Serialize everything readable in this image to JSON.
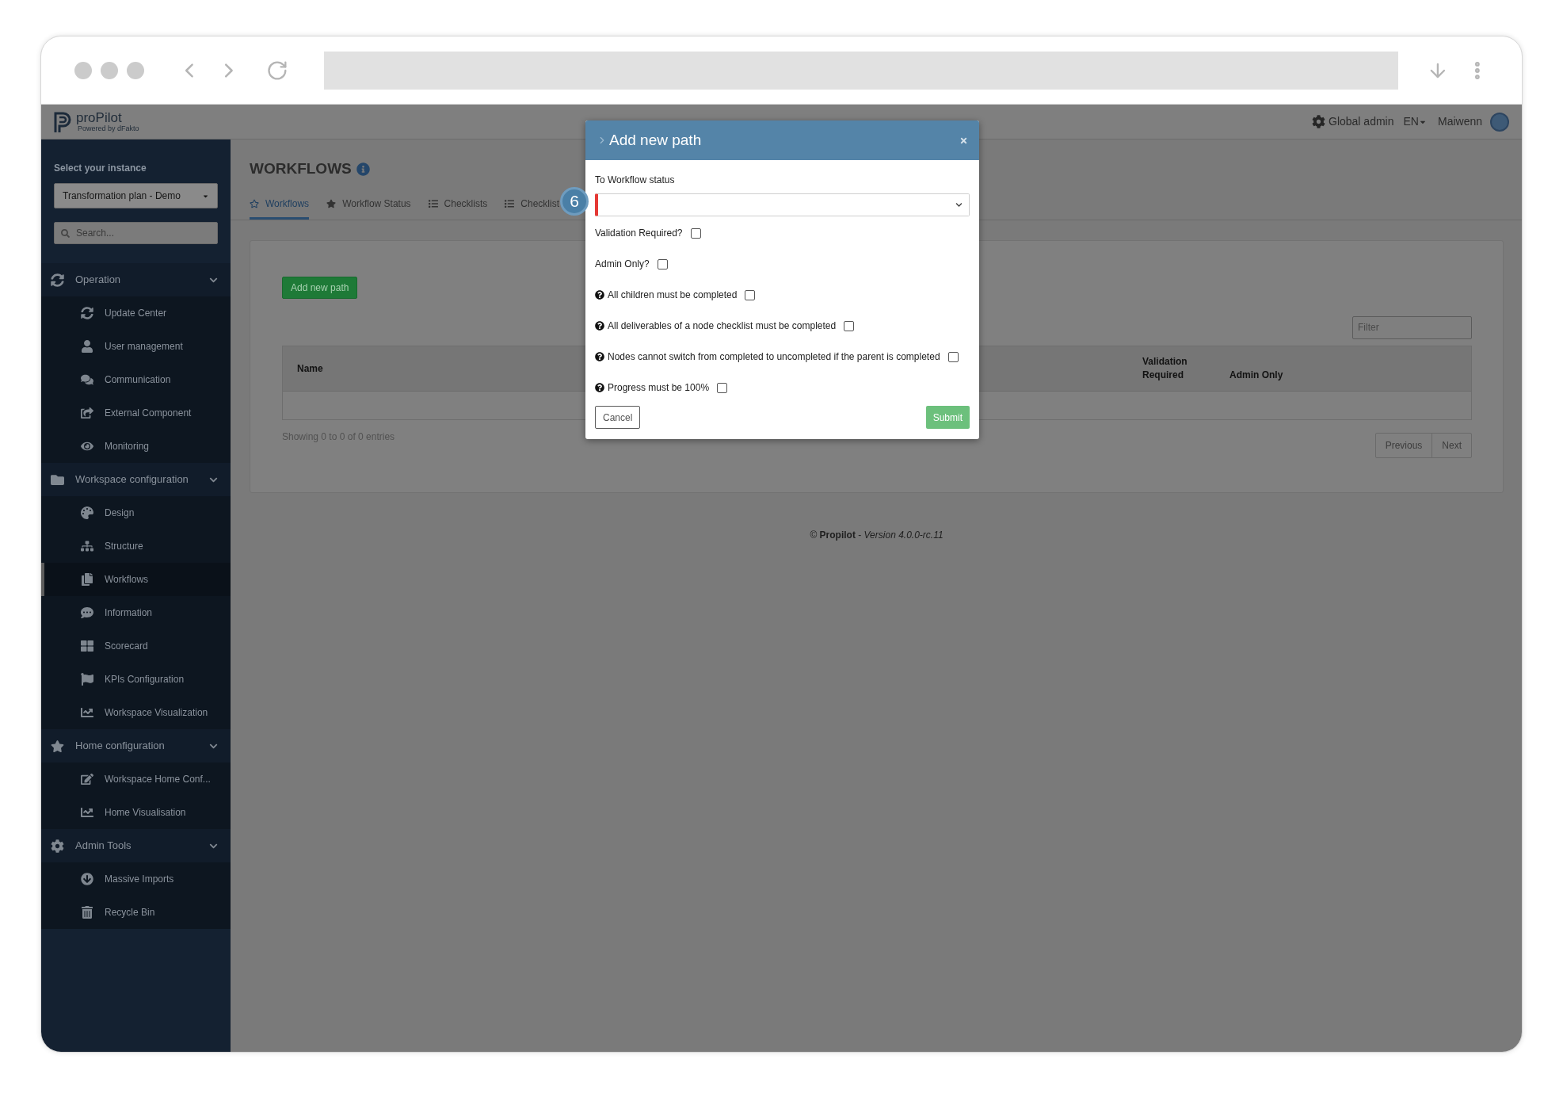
{
  "header": {
    "logo": "proPilot",
    "logo_tagline": "Powered by dFakto",
    "role": "Global admin",
    "language": "EN",
    "user": "Maiwenn"
  },
  "sidebar": {
    "instance_label": "Select your instance",
    "instance_value": "Transformation plan - Demo",
    "search_placeholder": "Search...",
    "groups": [
      {
        "label": "Operation",
        "expanded": true,
        "items": [
          {
            "label": "Update Center",
            "selected": false
          },
          {
            "label": "User management",
            "selected": false
          },
          {
            "label": "Communication",
            "selected": false
          },
          {
            "label": "External Component",
            "selected": false
          },
          {
            "label": "Monitoring",
            "selected": false
          }
        ]
      },
      {
        "label": "Workspace configuration",
        "expanded": true,
        "items": [
          {
            "label": "Design",
            "selected": false
          },
          {
            "label": "Structure",
            "selected": false
          },
          {
            "label": "Workflows",
            "selected": true
          },
          {
            "label": "Information",
            "selected": false
          },
          {
            "label": "Scorecard",
            "selected": false
          },
          {
            "label": "KPIs Configuration",
            "selected": false
          },
          {
            "label": "Workspace Visualization",
            "selected": false
          }
        ]
      },
      {
        "label": "Home configuration",
        "expanded": true,
        "items": [
          {
            "label": "Workspace Home Conf...",
            "selected": false
          },
          {
            "label": "Home Visualisation",
            "selected": false
          }
        ]
      },
      {
        "label": "Admin Tools",
        "expanded": true,
        "items": [
          {
            "label": "Massive Imports",
            "selected": false
          },
          {
            "label": "Recycle Bin",
            "selected": false
          }
        ]
      }
    ]
  },
  "page": {
    "title": "WORKFLOWS",
    "tabs": [
      {
        "label": "Workflows",
        "selected": true
      },
      {
        "label": "Workflow Status",
        "selected": false
      },
      {
        "label": "Checklists",
        "selected": false
      },
      {
        "label": "Checklist",
        "selected": false
      }
    ],
    "add_button": "Add new path",
    "filter_placeholder": "Filter",
    "table": {
      "columns": [
        "Name",
        "Validation Required",
        "Admin Only"
      ]
    },
    "info": "Showing 0 to 0 of 0 entries",
    "pagination": [
      "Previous",
      "Next"
    ]
  },
  "footer": "© **Propilot** - *Version 4.0.0-rc.11*",
  "step_badge": "6",
  "modal": {
    "title": "Add new path",
    "status_select": {
      "label": "To Workflow status",
      "invalid": true
    },
    "options": [
      {
        "label": "Validation Required?",
        "help": false,
        "checked": false
      },
      {
        "label": "Admin Only?",
        "help": false,
        "checked": false
      },
      {
        "label": "All children must be completed",
        "help": true,
        "checked": false
      },
      {
        "label": "All deliverables of a node checklist must be completed",
        "help": true,
        "checked": false
      },
      {
        "label": "Nodes cannot switch from completed to uncompleted if the parent is completed",
        "help": true,
        "checked": false
      },
      {
        "label": "Progress must be 100%",
        "help": true,
        "checked": false
      }
    ],
    "cancel": "Cancel",
    "submit": "Submit"
  }
}
